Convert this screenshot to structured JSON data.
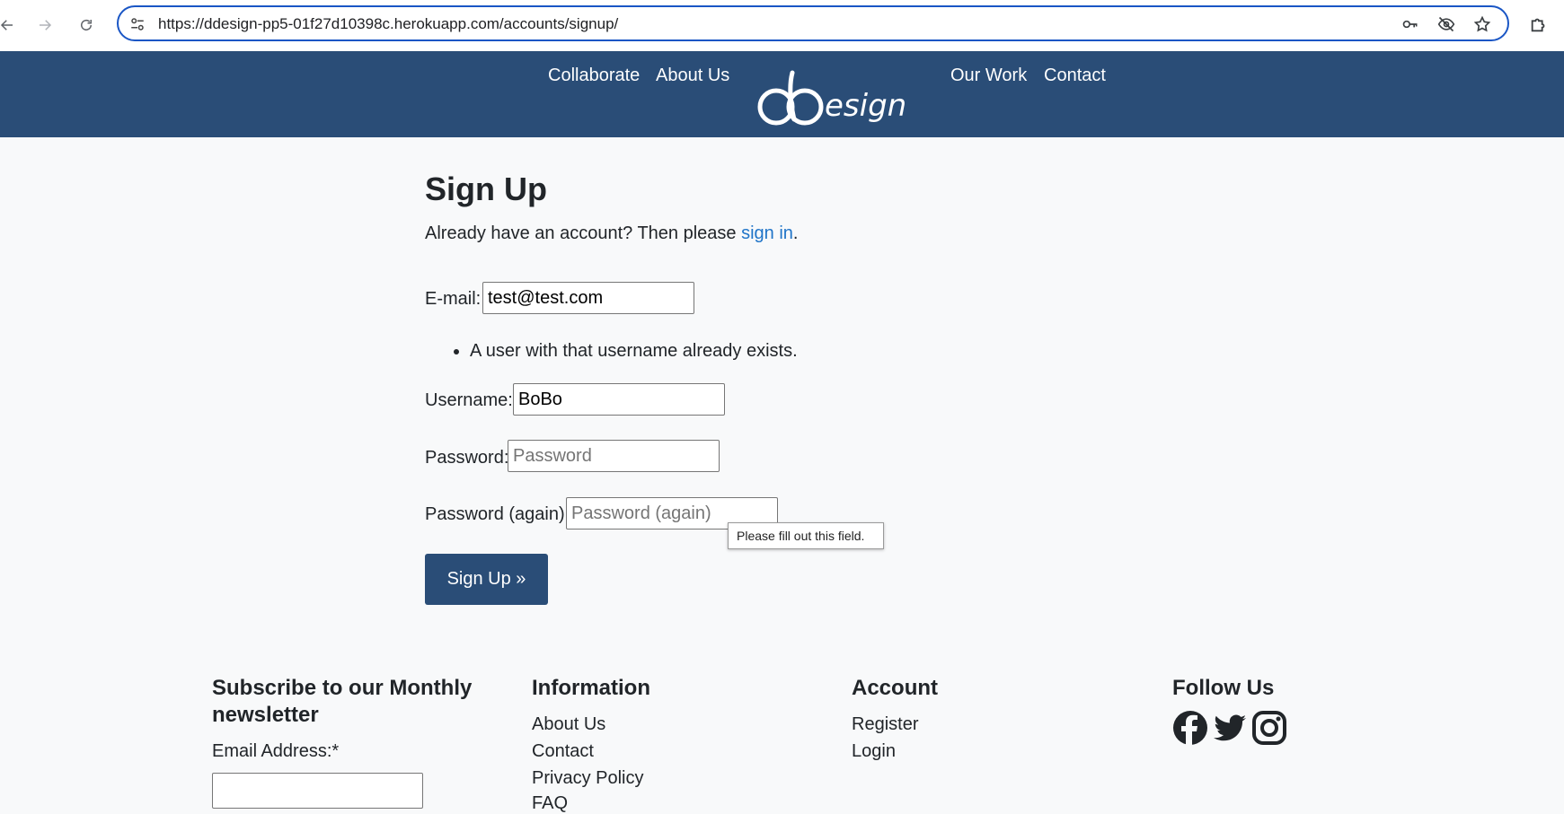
{
  "browser": {
    "url": "https://ddesign-pp5-01f27d10398c.herokuapp.com/accounts/signup/",
    "icons": [
      "back-icon",
      "forward-icon",
      "reload-icon",
      "site-settings-icon",
      "key-icon",
      "eye-off-icon",
      "star-icon",
      "extensions-icon"
    ]
  },
  "header": {
    "nav_left": [
      "Collaborate",
      "About Us"
    ],
    "nav_right": [
      "Our Work",
      "Contact"
    ],
    "logo_text": "ddesign",
    "bg_color": "#2a4d77"
  },
  "signup": {
    "title": "Sign Up",
    "intro_prefix": "Already have an account? Then please ",
    "intro_link": "sign in",
    "intro_suffix": ".",
    "email_label": "E-mail:",
    "email_value": "test@test.com",
    "error": "A user with that username already exists.",
    "username_label": "Username:",
    "username_value": "BoBo",
    "password_label": "Password:",
    "password_placeholder": "Password",
    "password2_label": "Password (again):",
    "password2_placeholder": "Password (again)",
    "tooltip": "Please fill out this field.",
    "submit_label": "Sign Up »"
  },
  "footer": {
    "newsletter": {
      "heading_line1": "Subscribe to our Monthly",
      "heading_line2": "newsletter",
      "email_label": "Email Address:*"
    },
    "information": {
      "heading": "Information",
      "links": [
        "About Us",
        "Contact",
        "Privacy Policy",
        "FAQ"
      ]
    },
    "account": {
      "heading": "Account",
      "links": [
        "Register",
        "Login"
      ]
    },
    "follow": {
      "heading": "Follow Us",
      "icons": [
        "facebook-icon",
        "twitter-icon",
        "instagram-icon"
      ]
    }
  }
}
